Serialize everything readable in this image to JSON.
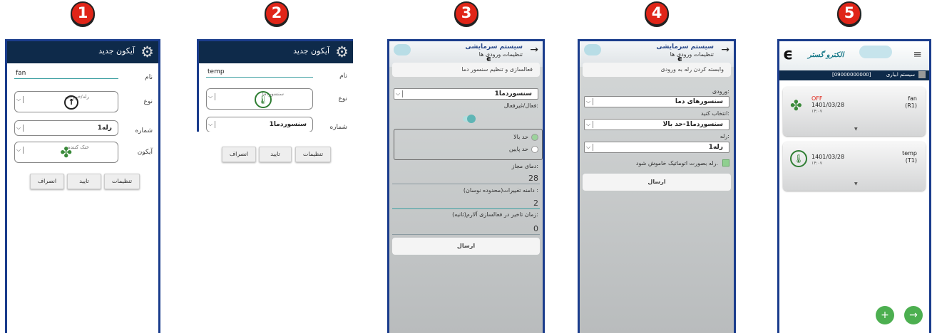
{
  "steps": [
    "1",
    "2",
    "3",
    "4",
    "5"
  ],
  "s1": {
    "title": "آیکون جدید",
    "name_label": "نام",
    "name_value": "fan",
    "type_label": "نوع",
    "type_caption": "رله/خروجی",
    "number_label": "شماره",
    "number_value": "رله1",
    "icon_label": "آیکون",
    "icon_caption": "خنک کننده",
    "btn_settings": "تنظیمات",
    "btn_confirm": "تایید",
    "btn_cancel": "انصراف"
  },
  "s2": {
    "title": "آیکون جدید",
    "name_label": "نام",
    "name_value": "temp",
    "type_label": "نوع",
    "type_caption": "سنسوردما",
    "number_label": "شماره",
    "number_value": "سنسوردما1",
    "btn_settings": "تنظیمات",
    "btn_confirm": "تایید",
    "btn_cancel": "انصراف"
  },
  "s3": {
    "header_title": "سیستم سرمایشی",
    "header_sub": "تنظیمات ورودی ها",
    "bar": "فعالسازی و تنظیم سنسور دما",
    "select_value": "سنسوردما1",
    "active_label": "فعال/غیرفعال:",
    "radio1": "حد بالا",
    "radio2": "حد پایین",
    "allowed_label": "دمای مجاز:",
    "allowed_value": "28",
    "range_label": "دامنه تغییرات(محدوده نوسان) :",
    "range_value": "2",
    "delay_label": "زمان تاخیر در فعالسازی آلارم(ثانیه):",
    "delay_value": "0",
    "send": "ارسال"
  },
  "s4": {
    "header_title": "سیستم سرمایشی",
    "header_sub": "تنظیمات ورودی ها",
    "bar": "وابسته کردن رله به ورودی",
    "input_label": "ورودی:",
    "input_value": "سنسورهای دما",
    "choose_label": "انتخاب کنید:",
    "choose_value": "سنسوردما1-حد بالا",
    "relay_label": "رله:",
    "relay_value": "رله1",
    "auto_off": "رله بصورت اتوماتیک خاموش شود.",
    "send": "ارسال"
  },
  "s5": {
    "logo_text": "الکترو گستر",
    "bar_title": "سیستم ابیاری",
    "bar_phone": "[09000000000]",
    "cards": [
      {
        "name": "fan",
        "id": "(R1)",
        "status": "OFF",
        "date": "1401/03/28",
        "time": "۱۴:۰۷"
      },
      {
        "name": "temp",
        "id": "(T1)",
        "status": "",
        "date": "1401/03/28",
        "time": "۱۴:۰۷"
      }
    ],
    "fab_add": "+",
    "fab_go": "→"
  },
  "icons": {
    "gear": "gear-icon",
    "back": "arrow-right-icon",
    "fan": "fan-icon",
    "thermometer": "thermometer-icon",
    "upload": "arrow-up-circle-icon"
  },
  "colors": {
    "badge": "#e02518",
    "dark_header": "#0e2a4a",
    "screen_border": "#1a3c8c",
    "fab": "#4caf50"
  }
}
